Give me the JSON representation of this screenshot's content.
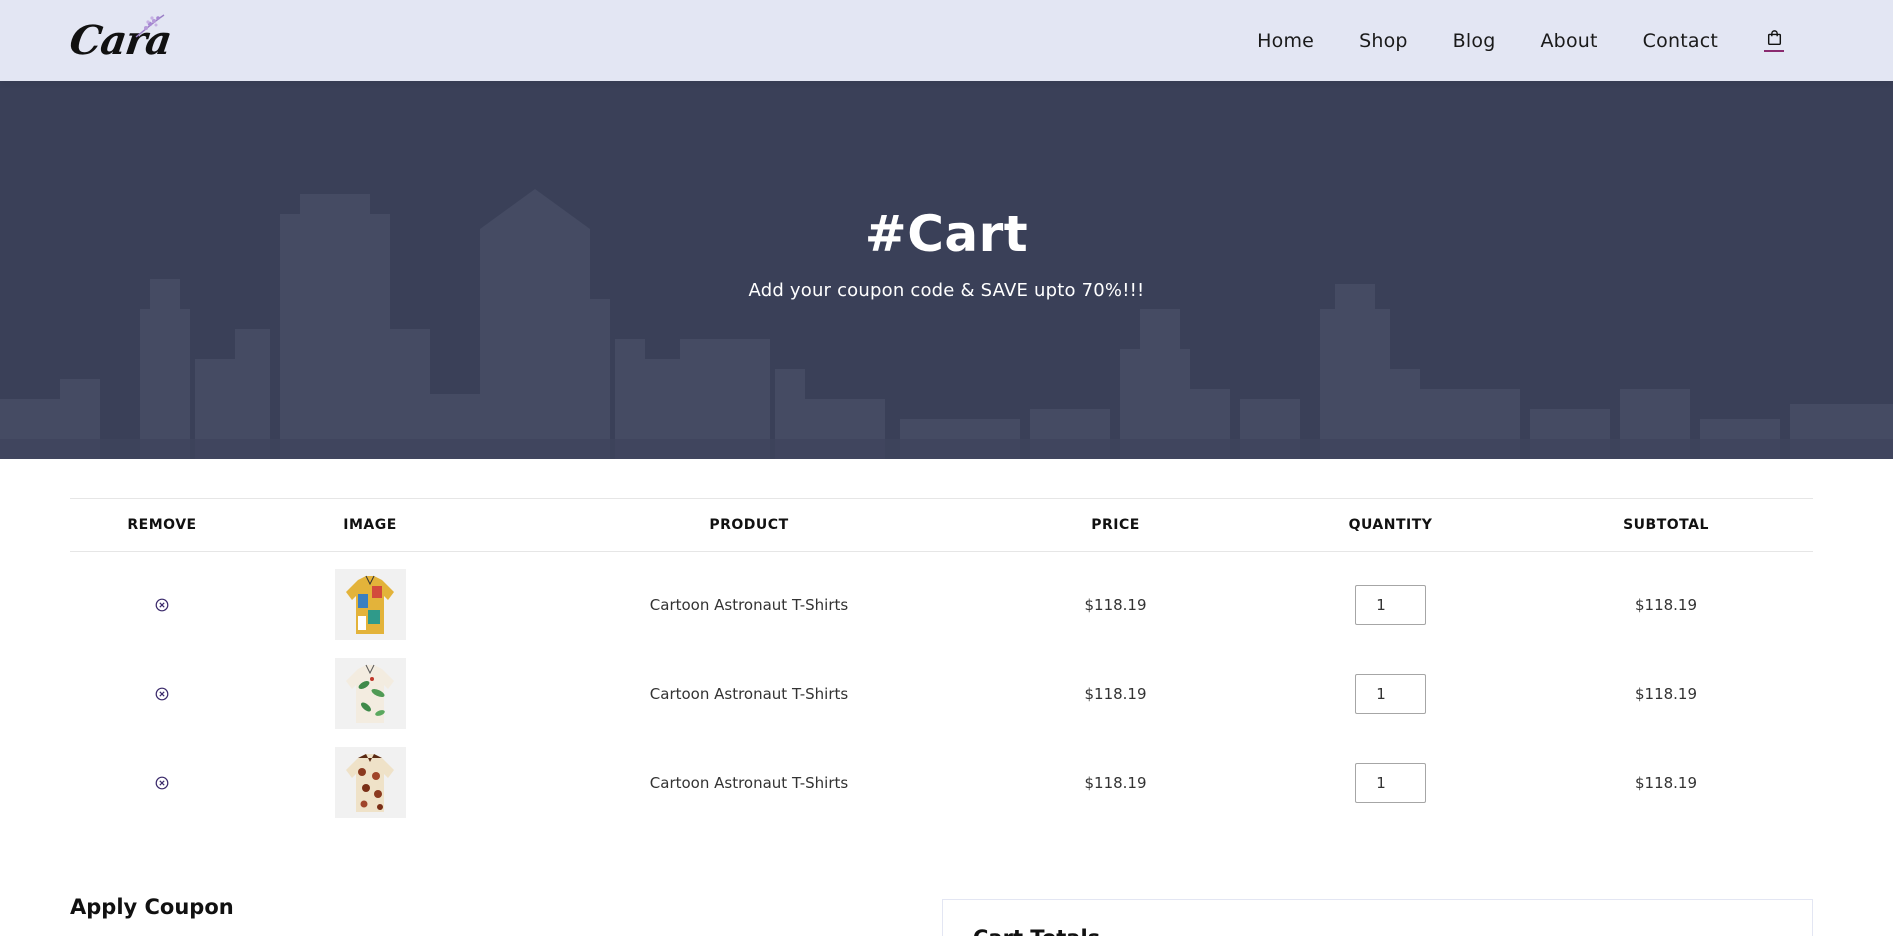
{
  "brand": {
    "logo_text": "Cara"
  },
  "nav": {
    "items": [
      {
        "label": "Home"
      },
      {
        "label": "Shop"
      },
      {
        "label": "Blog"
      },
      {
        "label": "About"
      },
      {
        "label": "Contact"
      }
    ],
    "cart_icon": "shopping-bag-icon",
    "active_color": "#8a2a6f"
  },
  "hero": {
    "title": "#Cart",
    "subtitle": "Add your coupon code & SAVE upto 70%!!!"
  },
  "cart_table": {
    "headers": [
      "REMOVE",
      "IMAGE",
      "PRODUCT",
      "PRICE",
      "QUANTITY",
      "SUBTOTAL"
    ],
    "rows": [
      {
        "product": "Cartoon Astronaut T-Shirts",
        "price": "$118.19",
        "quantity": "1",
        "subtotal": "$118.19",
        "remove_icon": "close-circle-icon",
        "image_icon": "shirt-icon"
      },
      {
        "product": "Cartoon Astronaut T-Shirts",
        "price": "$118.19",
        "quantity": "1",
        "subtotal": "$118.19",
        "remove_icon": "close-circle-icon",
        "image_icon": "shirt-icon"
      },
      {
        "product": "Cartoon Astronaut T-Shirts",
        "price": "$118.19",
        "quantity": "1",
        "subtotal": "$118.19",
        "remove_icon": "close-circle-icon",
        "image_icon": "shirt-icon"
      }
    ]
  },
  "coupon": {
    "heading": "Apply Coupon"
  },
  "totals": {
    "heading": "Cart Totals"
  },
  "colors": {
    "header_bg": "#e3e6f3",
    "hero_bg": "#3a4058",
    "accent": "#6a4c93"
  }
}
